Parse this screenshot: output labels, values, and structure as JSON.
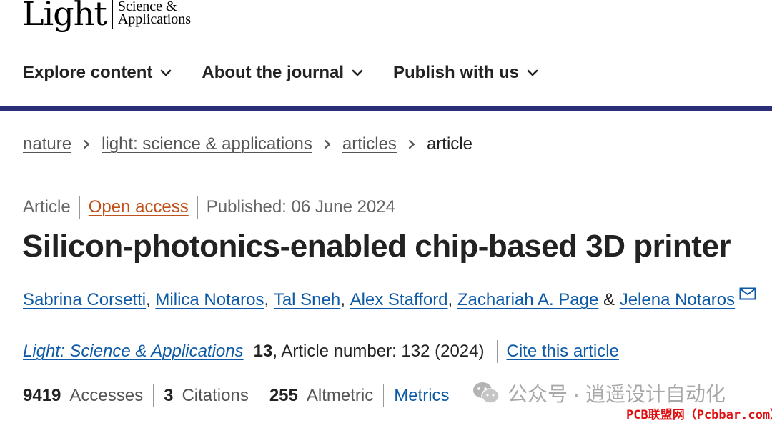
{
  "logo": {
    "main": "Light",
    "sub_line1": "Science &",
    "sub_line2": "Applications"
  },
  "nav": {
    "items": [
      {
        "label": "Explore content"
      },
      {
        "label": "About the journal"
      },
      {
        "label": "Publish with us"
      }
    ]
  },
  "breadcrumb": {
    "items": [
      {
        "label": "nature"
      },
      {
        "label": "light: science & applications"
      },
      {
        "label": "articles"
      }
    ],
    "current": "article"
  },
  "article": {
    "type": "Article",
    "access": "Open access",
    "published": "Published: 06 June 2024",
    "title": "Silicon-photonics-enabled chip-based 3D printer",
    "authors": [
      {
        "name": "Sabrina Corsetti"
      },
      {
        "name": "Milica Notaros"
      },
      {
        "name": "Tal Sneh"
      },
      {
        "name": "Alex Stafford"
      },
      {
        "name": "Zachariah A. Page"
      },
      {
        "name": "Jelena Notaros"
      }
    ],
    "author_sep": ",",
    "author_and": "&",
    "journal": "Light: Science & Applications",
    "volume": "13",
    "article_number": ", Article number: 132 (2024)",
    "cite_label": "Cite this article"
  },
  "metrics": {
    "accesses_value": "9419",
    "accesses_label": "Accesses",
    "citations_value": "3",
    "citations_label": "Citations",
    "altmetric_value": "255",
    "altmetric_label": "Altmetric",
    "metrics_link": "Metrics"
  },
  "watermark": {
    "text": "公众号 · 逍遥设计自动化",
    "site": "PCB联盟网（Pcbbar.com）"
  },
  "colors": {
    "link": "#0d5aa7",
    "open_access": "#c0501a",
    "nav_bar": "#2b2f78",
    "watermark_red": "#e01010"
  }
}
